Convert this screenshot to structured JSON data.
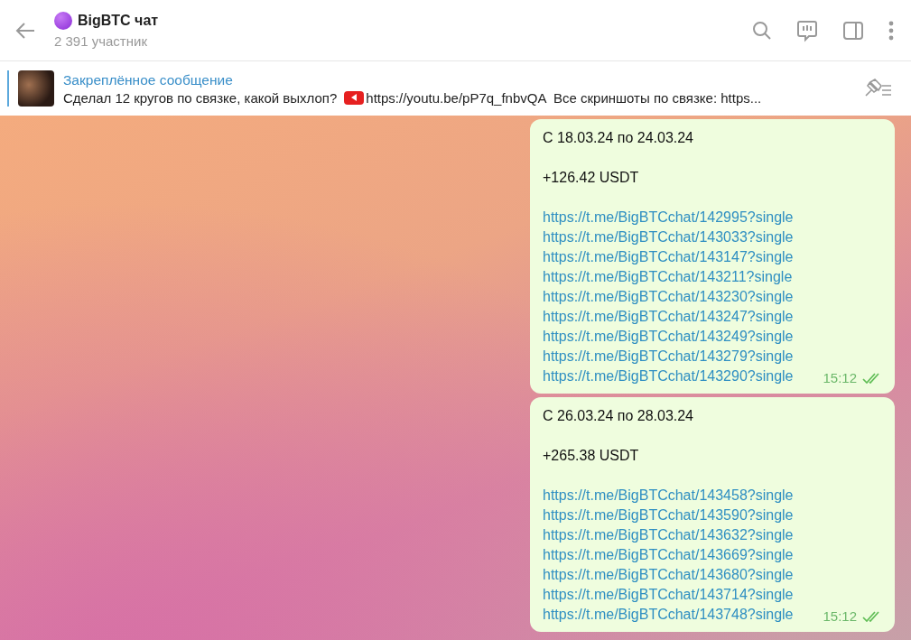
{
  "header": {
    "title": "BigBTC чат",
    "subtitle": "2 391 участник"
  },
  "pinned": {
    "label": "Закреплённое сообщение",
    "text_before": "Сделал 12 кругов по связке, какой выхлоп?",
    "text_after": "https://youtu.be/pP7q_fnbvQA  Все скриншоты по связке: https..."
  },
  "messages": [
    {
      "period": "С 18.03.24 по 24.03.24",
      "amount": "+126.42 USDT",
      "links": [
        "https://t.me/BigBTCchat/142995?single",
        "https://t.me/BigBTCchat/143033?single",
        "https://t.me/BigBTCchat/143147?single",
        "https://t.me/BigBTCchat/143211?single",
        "https://t.me/BigBTCchat/143230?single",
        "https://t.me/BigBTCchat/143247?single",
        "https://t.me/BigBTCchat/143249?single",
        "https://t.me/BigBTCchat/143279?single",
        "https://t.me/BigBTCchat/143290?single"
      ],
      "time": "15:12",
      "read": true
    },
    {
      "period": "С 26.03.24 по 28.03.24",
      "amount": "+265.38 USDT",
      "links": [
        "https://t.me/BigBTCchat/143458?single",
        "https://t.me/BigBTCchat/143590?single",
        "https://t.me/BigBTCchat/143632?single",
        "https://t.me/BigBTCchat/143669?single",
        "https://t.me/BigBTCchat/143680?single",
        "https://t.me/BigBTCchat/143714?single",
        "https://t.me/BigBTCchat/143748?single"
      ],
      "time": "15:12",
      "read": true
    }
  ]
}
